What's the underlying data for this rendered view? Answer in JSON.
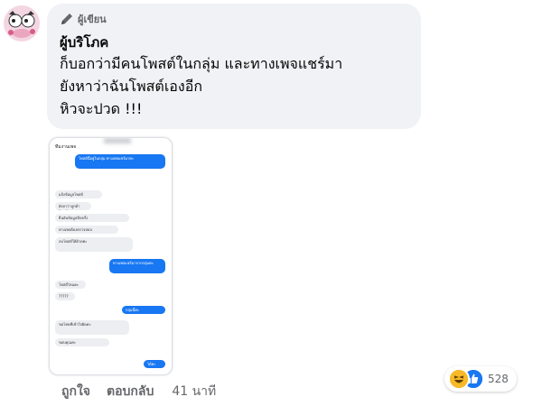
{
  "comment": {
    "badge_label": "ผู้เขียน",
    "author": "ผู้บริโภค",
    "lines": [
      "ก็บอกว่ามีคนโพสต์ในกลุ่ม และทางเพจแชร์มา",
      "ยังหาว่าฉันโพสต์เองอีก",
      "หิวจะปวด !!!"
    ]
  },
  "attachment": {
    "chat_name": "ทีมงานเพจ",
    "messages": [
      {
        "side": "out",
        "text": "โพสต์นี้อยู่ในกลุ่ม ทางเพจแชร์มาค่ะ"
      },
      {
        "side": "in",
        "text": "แจ้งข้อมูลโพสต์"
      },
      {
        "side": "in",
        "text": "ยังหาว่าลูกค้าโพสต์เอง"
      },
      {
        "side": "in",
        "text": "ยืนยันข้อมูลอีกครั้ง"
      },
      {
        "side": "in",
        "text": "ทางเพจต้องตรวจสอบ"
      },
      {
        "side": "in",
        "text": "ลบโพสต์ให้ด้วยค่ะ"
      },
      {
        "side": "out",
        "text": "ทางเพจแชร์มาจากกลุ่มค่ะ"
      },
      {
        "side": "in",
        "text": "โพสต์ไหนคะ"
      },
      {
        "side": "in",
        "text": "?????"
      },
      {
        "side": "out",
        "text": "กลุ่มนี้ค่ะ"
      },
      {
        "side": "in",
        "text": "ขอโทษที่เข้าใจผิดค่ะ"
      },
      {
        "side": "in",
        "text": "ขอบคุณค่ะ"
      },
      {
        "side": "out",
        "text": "ได้ค่ะ"
      }
    ]
  },
  "actions": {
    "like": "ถูกใจ",
    "reply": "ตอบกลับ",
    "time": "41 นาที"
  },
  "reactions": {
    "count": "528",
    "types": [
      "haha-icon",
      "like-icon"
    ]
  },
  "colors": {
    "bubble_bg": "#f0f2f5",
    "messenger_blue": "#1877f2",
    "secondary_text": "#65676b"
  }
}
